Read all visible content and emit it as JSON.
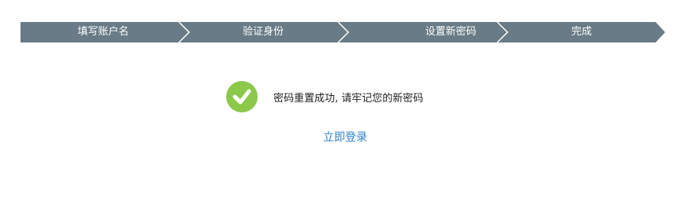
{
  "steps": [
    {
      "label": "填写账户名"
    },
    {
      "label": "验证身份"
    },
    {
      "label": "设置新密码"
    },
    {
      "label": "完成"
    }
  ],
  "colors": {
    "step_bar": "#687b86",
    "step_divider": "#ffffff",
    "success_icon": "#8cc94b",
    "link": "#2a7fc9"
  },
  "result": {
    "icon": "checkmark-icon",
    "message": "密码重置成功, 请牢记您的新密码"
  },
  "actions": {
    "login_label": "立即登录"
  }
}
